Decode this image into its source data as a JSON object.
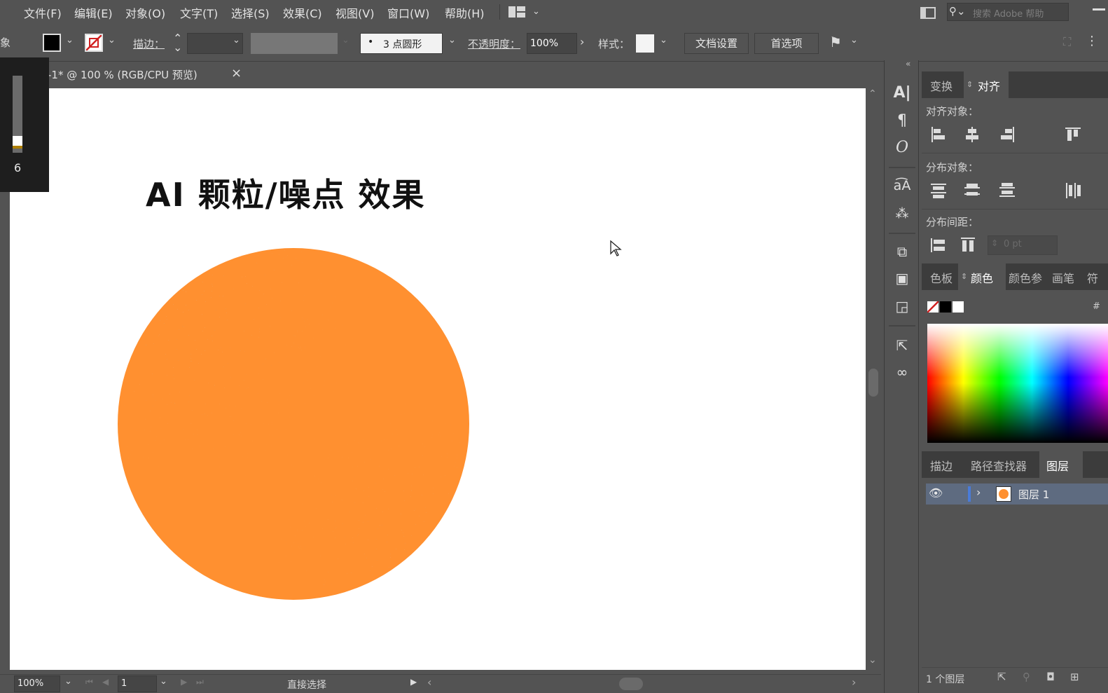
{
  "menu": {
    "items": [
      "文件(F)",
      "编辑(E)",
      "对象(O)",
      "文字(T)",
      "选择(S)",
      "效果(C)",
      "视图(V)",
      "窗口(W)",
      "帮助(H)"
    ],
    "search_placeholder": "搜索 Adobe 帮助"
  },
  "control_bar": {
    "left_cut_label": "象",
    "stroke_label": "描边：",
    "brush_label": "3 点圆形",
    "opacity_label": "不透明度：",
    "opacity_value": "100%",
    "style_label": "样式：",
    "doc_setup_button": "文档设置",
    "preferences_button": "首选项"
  },
  "document_tab": {
    "title": "-1* @ 100 % (RGB/CPU 预览)",
    "close": "×",
    "prefix_glyph": "⊡"
  },
  "brush_popup": {
    "size_value": "6"
  },
  "artboard": {
    "heading": "AI 颗粒/噪点 效果",
    "circle_color": "#FF9030"
  },
  "status_bar": {
    "zoom": "100%",
    "page": "1",
    "tool_name": "直接选择"
  },
  "align_panel": {
    "tabs": [
      "变换",
      "对齐"
    ],
    "align_objects_label": "对齐对象：",
    "distribute_objects_label": "分布对象：",
    "distribute_spacing_label": "分布间距：",
    "spacing_value": "0 pt"
  },
  "color_panel": {
    "tabs": [
      "色板",
      "颜色",
      "颜色参",
      "画笔",
      "符"
    ],
    "hash": "#"
  },
  "layers_panel": {
    "tabs": [
      "描边",
      "路径查找器",
      "图层"
    ],
    "layer_name": "图层 1",
    "footer_count": "1 个图层"
  },
  "colors": {
    "ui_bg": "#535353",
    "accent_orange": "#FF9030",
    "layer_blue": "#4a7bd8"
  }
}
